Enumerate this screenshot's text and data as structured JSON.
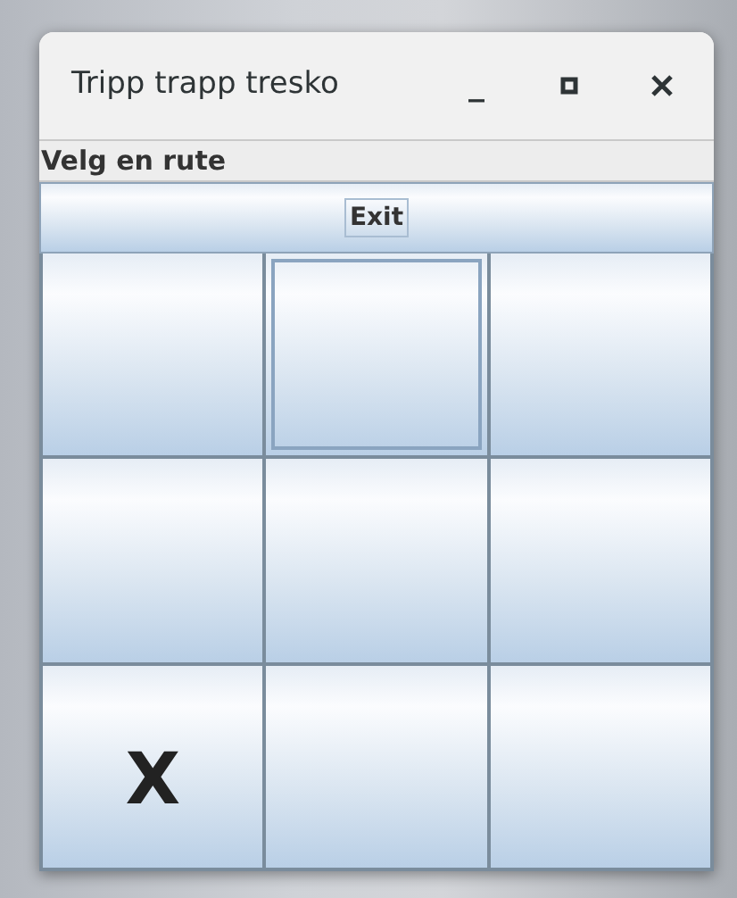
{
  "window": {
    "title": "Tripp trapp tresko",
    "controls": [
      {
        "kind": "minimize",
        "label": "_"
      },
      {
        "kind": "maximize"
      },
      {
        "kind": "close"
      }
    ]
  },
  "status": "Velg en rute",
  "exit_button": "Exit",
  "board": [
    {
      "focused": false
    },
    {
      "focused": true
    },
    {
      "focused": false
    },
    {
      "focused": false
    },
    {
      "focused": false
    },
    {
      "focused": false
    },
    {
      "focused": false,
      "mark": "X"
    },
    {
      "focused": false
    },
    {
      "focused": false
    }
  ]
}
